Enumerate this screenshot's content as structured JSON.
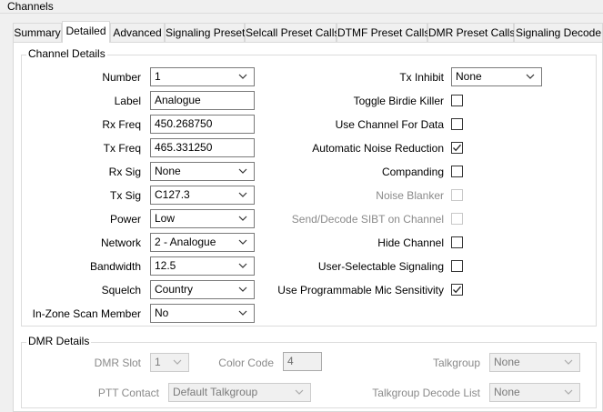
{
  "window": {
    "title": "Channels"
  },
  "tabs": [
    "Summary",
    "Detailed",
    "Advanced",
    "Signaling Preset",
    "Selcall Preset Calls",
    "DTMF Preset Calls",
    "DMR Preset Calls",
    "Signaling Decode"
  ],
  "channel_details": {
    "group_label": "Channel Details",
    "number": {
      "label": "Number",
      "value": "1"
    },
    "label": {
      "label": "Label",
      "value": "Analogue"
    },
    "rx_freq": {
      "label": "Rx Freq",
      "value": "450.268750"
    },
    "tx_freq": {
      "label": "Tx Freq",
      "value": "465.331250"
    },
    "rx_sig": {
      "label": "Rx Sig",
      "value": "None"
    },
    "tx_sig": {
      "label": "Tx Sig",
      "value": "C127.3"
    },
    "power": {
      "label": "Power",
      "value": "Low"
    },
    "network": {
      "label": "Network",
      "value": "2 - Analogue"
    },
    "bandwidth": {
      "label": "Bandwidth",
      "value": "12.5"
    },
    "squelch": {
      "label": "Squelch",
      "value": "Country"
    },
    "in_zone_scan": {
      "label": "In-Zone Scan Member",
      "value": "No"
    },
    "tx_inhibit": {
      "label": "Tx Inhibit",
      "value": "None"
    },
    "checks": [
      {
        "label": "Toggle Birdie Killer",
        "checked": false,
        "enabled": true
      },
      {
        "label": "Use Channel For Data",
        "checked": false,
        "enabled": true
      },
      {
        "label": "Automatic Noise Reduction",
        "checked": true,
        "enabled": true
      },
      {
        "label": "Companding",
        "checked": false,
        "enabled": true
      },
      {
        "label": "Noise Blanker",
        "checked": false,
        "enabled": false
      },
      {
        "label": "Send/Decode SIBT on Channel",
        "checked": false,
        "enabled": false
      },
      {
        "label": "Hide Channel",
        "checked": false,
        "enabled": true
      },
      {
        "label": "User-Selectable Signaling",
        "checked": false,
        "enabled": true
      },
      {
        "label": "Use Programmable Mic Sensitivity",
        "checked": true,
        "enabled": true
      }
    ]
  },
  "dmr_details": {
    "group_label": "DMR Details",
    "dmr_slot": {
      "label": "DMR Slot",
      "value": "1"
    },
    "color_code": {
      "label": "Color Code",
      "value": "4"
    },
    "talkgroup": {
      "label": "Talkgroup",
      "value": "None"
    },
    "ptt_contact": {
      "label": "PTT Contact",
      "value": "Default Talkgroup"
    },
    "talkgroup_decode": {
      "label": "Talkgroup Decode List",
      "value": "None"
    }
  },
  "colors": {
    "window_bg": "#f0f0f0",
    "panel_bg": "#ffffff",
    "border": "#7a7a7a",
    "disabled_text": "#8a8a8a"
  }
}
